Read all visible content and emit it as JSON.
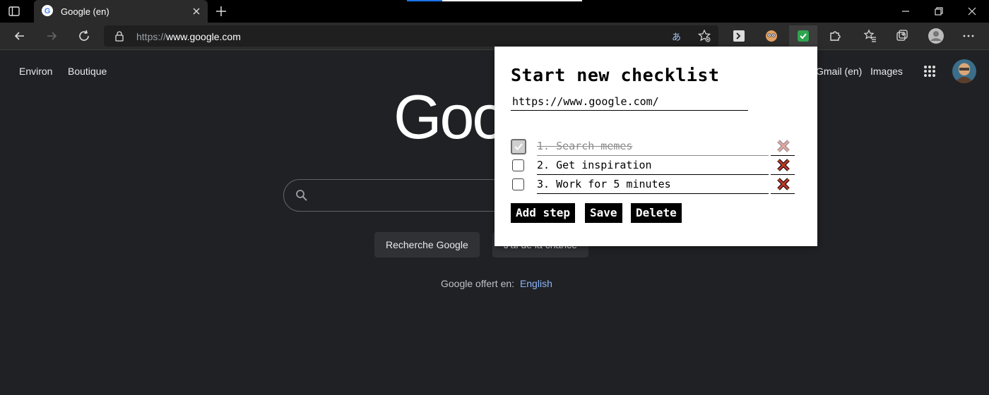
{
  "browser": {
    "tab_title": "Google (en)",
    "url_scheme": "https://",
    "url_host": "www.google.com",
    "read_aloud_glyph": "あ"
  },
  "google": {
    "top_left_links": [
      "Environ",
      "Boutique"
    ],
    "top_right_links": [
      "Gmail (en)",
      "Images"
    ],
    "logo_visible": "Goo",
    "search_button": "Recherche Google",
    "lucky_button": "J'ai de la chance",
    "offered_in": "Google offert en:",
    "language_link": "English"
  },
  "popup": {
    "title": "Start new checklist",
    "url_value": "https://www.google.com/",
    "steps": [
      {
        "text": "1. Search memes",
        "done": true
      },
      {
        "text": "2. Get inspiration",
        "done": false
      },
      {
        "text": "3. Work for 5 minutes",
        "done": false
      }
    ],
    "buttons": {
      "add_step": "Add step",
      "save": "Save",
      "delete": "Delete"
    }
  },
  "colors": {
    "page_bg": "#202124",
    "accent_blue": "#8ab4f8",
    "delete_red": "#c0392b"
  }
}
